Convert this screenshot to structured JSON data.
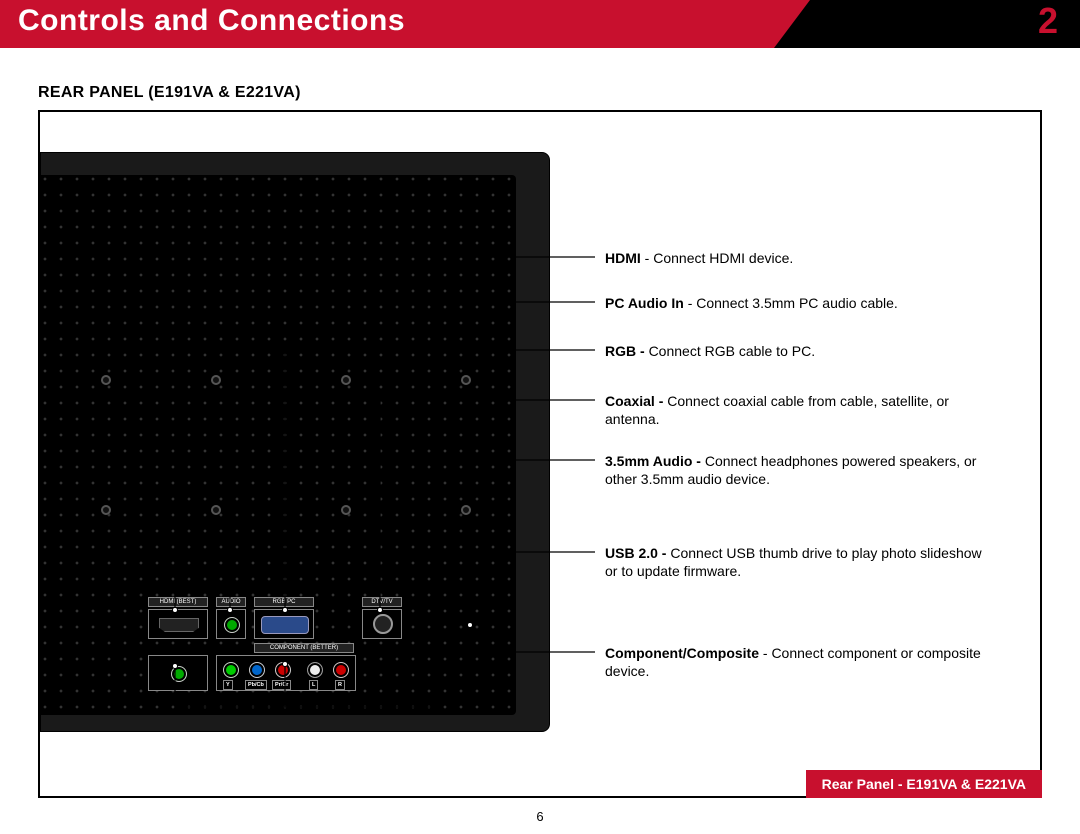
{
  "header": {
    "title": "Controls and Connections",
    "chapter": "2"
  },
  "subhead": "REAR PANEL (E191VA & E221VA)",
  "ports": {
    "hdmi_label": "HDMI (BEST)",
    "audio_label": "AUDIO",
    "rgb_label": "RGB PC",
    "dtv_label": "DTV/TV",
    "component_label": "COMPONENT (BETTER)",
    "y": "Y",
    "pb": "Pb/Cb",
    "pr": "Pr/Cr",
    "l": "L",
    "r": "R"
  },
  "callouts": {
    "hdmi_bold": "HDMI",
    "hdmi_text": " - Connect HDMI device.",
    "pcaudio_bold": "PC Audio In",
    "pcaudio_text": " - Connect 3.5mm PC audio cable.",
    "rgb_bold": "RGB - ",
    "rgb_text": "Connect RGB cable to PC.",
    "coax_bold": "Coaxial - ",
    "coax_text": "Connect coaxial cable from cable, satellite, or antenna.",
    "audio35_bold": "3.5mm Audio - ",
    "audio35_text": "Connect headphones powered speakers, or other 3.5mm audio device.",
    "usb_bold": "USB 2.0 - ",
    "usb_text": "Connect USB thumb drive to play photo slideshow or to update firmware.",
    "comp_bold": "Component/Composite",
    "comp_text": " - Connect component or composite device."
  },
  "caption": "Rear Panel - E191VA & E221VA",
  "page_number": "6"
}
